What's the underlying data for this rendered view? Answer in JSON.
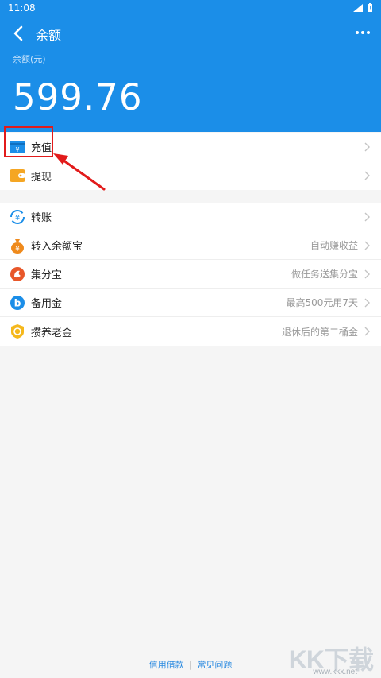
{
  "status_bar": {
    "time": "11:08"
  },
  "nav": {
    "title": "余额"
  },
  "balance": {
    "label": "余额(元)",
    "value": "599.76"
  },
  "list1": [
    {
      "label": "充值",
      "sub": ""
    },
    {
      "label": "提现",
      "sub": ""
    }
  ],
  "list2": [
    {
      "label": "转账",
      "sub": ""
    },
    {
      "label": "转入余额宝",
      "sub": "自动赚收益"
    },
    {
      "label": "集分宝",
      "sub": "做任务送集分宝"
    },
    {
      "label": "备用金",
      "sub": "最高500元用7天"
    },
    {
      "label": "攒养老金",
      "sub": "退休后的第二桶金"
    }
  ],
  "footer": {
    "link1": "信用借款",
    "separator": "|",
    "link2": "常见问题"
  },
  "watermark": {
    "text": "KK下载",
    "url": "www.kkx.net"
  },
  "colors": {
    "header": "#1b8ee8",
    "highlight": "#e21b1b",
    "link": "#2a8ae0"
  },
  "icons": [
    "back-arrow-icon",
    "more-icon",
    "recharge-card-icon",
    "withdraw-wallet-icon",
    "transfer-icon",
    "money-bag-icon",
    "jifenbao-icon",
    "beiyongjin-icon",
    "pension-icon",
    "chevron-right-icon"
  ]
}
